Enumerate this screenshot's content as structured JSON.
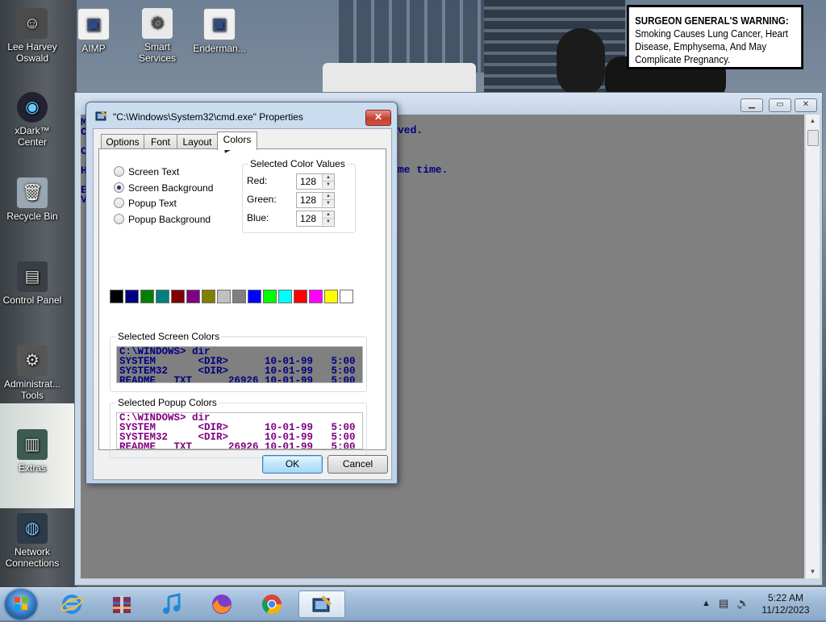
{
  "desktop": {
    "icons": [
      {
        "label": "Lee Harvey Oswald",
        "glyph": "☺"
      },
      {
        "label": "AIMP",
        "glyph": "▣"
      },
      {
        "label": "Smart Services",
        "glyph": "⚙"
      },
      {
        "label": "Enderman...",
        "glyph": "▣"
      },
      {
        "label": "xDark™ Center",
        "glyph": "◉"
      },
      {
        "label": "Recycle Bin",
        "glyph": "🗑"
      },
      {
        "label": "Control Panel",
        "glyph": "▤"
      },
      {
        "label": "Administrat... Tools",
        "glyph": "⚙"
      },
      {
        "label": "Extras",
        "glyph": "▥"
      },
      {
        "label": "Network Connections",
        "glyph": "◍"
      }
    ]
  },
  "warning": {
    "heading": "SURGEON GENERAL'S WARNING:",
    "text": "Smoking Causes Lung Cancer, Heart Disease, Emphysema, And May Complicate Pregnancy."
  },
  "console": {
    "lines_left": [
      "M",
      "C",
      "",
      "C",
      "",
      "H",
      "",
      "E",
      "V"
    ],
    "line_right_1": "ved.",
    "line_right_2": "me time.",
    "buttons": {
      "minimize": "▁",
      "maximize": "▭",
      "close": "✕"
    },
    "colors": {
      "background": "#808080",
      "text": "#000080"
    }
  },
  "dialog": {
    "title": "\"C:\\Windows\\System32\\cmd.exe\" Properties",
    "close": "✕",
    "tabs": [
      "Options",
      "Font",
      "Layout",
      "Colors"
    ],
    "active_tab": "Colors",
    "radios": [
      {
        "label": "Screen Text",
        "selected": false
      },
      {
        "label": "Screen Background",
        "selected": true
      },
      {
        "label": "Popup Text",
        "selected": false
      },
      {
        "label": "Popup Background",
        "selected": false
      }
    ],
    "color_values": {
      "legend": "Selected Color Values",
      "red_label": "Red:",
      "red": "128",
      "green_label": "Green:",
      "green": "128",
      "blue_label": "Blue:",
      "blue": "128"
    },
    "palette": [
      "#000000",
      "#000080",
      "#008000",
      "#008080",
      "#800000",
      "#800080",
      "#808000",
      "#c0c0c0",
      "#808080",
      "#0000ff",
      "#00ff00",
      "#00ffff",
      "#ff0000",
      "#ff00ff",
      "#ffff00",
      "#ffffff"
    ],
    "screen_preview": {
      "legend": "Selected Screen Colors",
      "lines": [
        "C:\\WINDOWS> dir",
        "SYSTEM       <DIR>      10-01-99   5:00",
        "SYSTEM32     <DIR>      10-01-99   5:00",
        "README   TXT      26926 10-01-99   5:00"
      ],
      "background": "#808080",
      "text": "#000080"
    },
    "popup_preview": {
      "legend": "Selected Popup Colors",
      "lines": [
        "C:\\WINDOWS> dir",
        "SYSTEM       <DIR>      10-01-99   5:00",
        "SYSTEM32     <DIR>      10-01-99   5:00",
        "README   TXT      26926 10-01-99   5:00"
      ],
      "background": "#ffffff",
      "text": "#800080"
    },
    "ok": "OK",
    "cancel": "Cancel"
  },
  "taskbar": {
    "apps": [
      "internet-explorer",
      "archive-tool",
      "music-player",
      "firefox",
      "chrome",
      "cmd-properties"
    ],
    "clock_time": "5:22 AM",
    "clock_date": "11/12/2023"
  }
}
